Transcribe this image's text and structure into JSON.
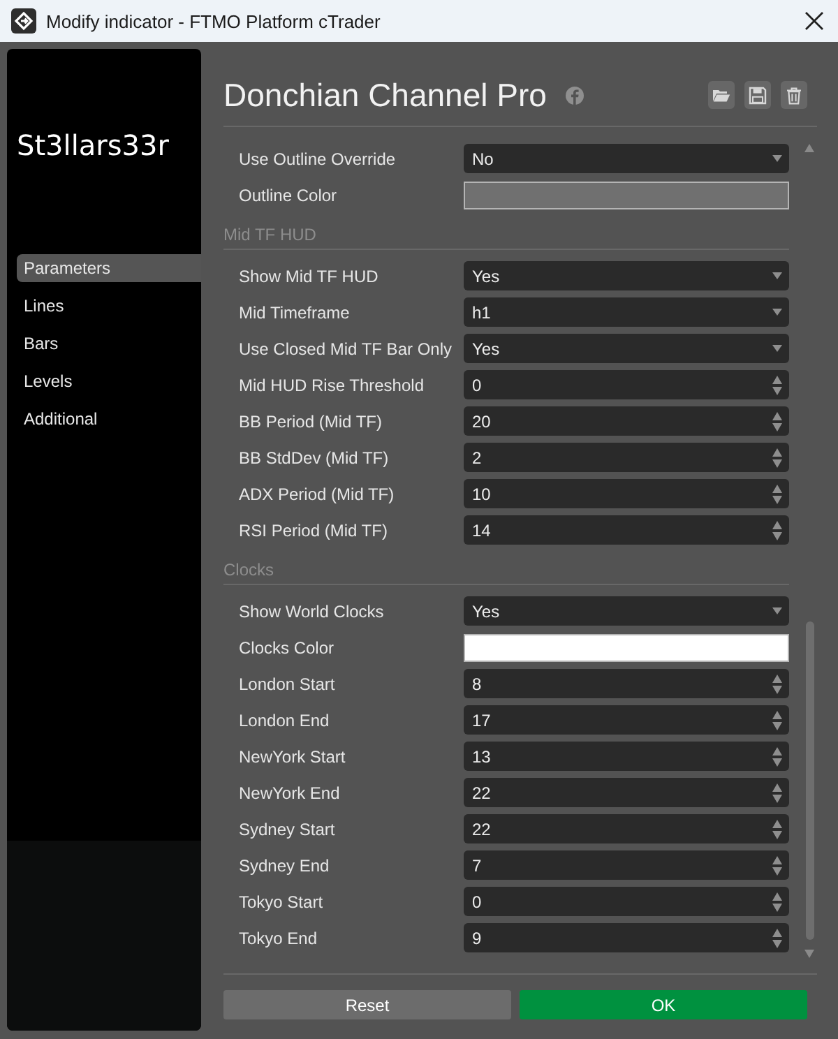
{
  "window": {
    "title": "Modify indicator - FTMO Platform cTrader"
  },
  "sidebar": {
    "logo": "St3llars33r",
    "items": [
      {
        "label": "Parameters",
        "selected": true
      },
      {
        "label": "Lines",
        "selected": false
      },
      {
        "label": "Bars",
        "selected": false
      },
      {
        "label": "Levels",
        "selected": false
      },
      {
        "label": "Additional",
        "selected": false
      }
    ]
  },
  "header": {
    "title": "Donchian Channel Pro"
  },
  "sections": [
    {
      "rows": [
        {
          "label": "Use Outline Override",
          "kind": "dropdown",
          "value": "No"
        },
        {
          "label": "Outline Color",
          "kind": "color",
          "color": "#707070"
        }
      ]
    },
    {
      "title": "Mid TF HUD",
      "rows": [
        {
          "label": "Show Mid TF HUD",
          "kind": "dropdown",
          "value": "Yes"
        },
        {
          "label": "Mid Timeframe",
          "kind": "dropdown",
          "value": "h1"
        },
        {
          "label": "Use Closed Mid TF Bar Only",
          "kind": "dropdown",
          "value": "Yes"
        },
        {
          "label": "Mid HUD Rise Threshold",
          "kind": "number",
          "value": "0"
        },
        {
          "label": "BB Period (Mid TF)",
          "kind": "number",
          "value": "20"
        },
        {
          "label": "BB StdDev (Mid TF)",
          "kind": "number",
          "value": "2"
        },
        {
          "label": "ADX Period (Mid TF)",
          "kind": "number",
          "value": "10"
        },
        {
          "label": "RSI Period (Mid TF)",
          "kind": "number",
          "value": "14"
        }
      ]
    },
    {
      "title": "Clocks",
      "rows": [
        {
          "label": "Show World Clocks",
          "kind": "dropdown",
          "value": "Yes"
        },
        {
          "label": "Clocks Color",
          "kind": "color",
          "color": "#ffffff"
        },
        {
          "label": "London Start",
          "kind": "number",
          "value": "8"
        },
        {
          "label": "London End",
          "kind": "number",
          "value": "17"
        },
        {
          "label": "NewYork Start",
          "kind": "number",
          "value": "13"
        },
        {
          "label": "NewYork End",
          "kind": "number",
          "value": "22"
        },
        {
          "label": "Sydney Start",
          "kind": "number",
          "value": "22"
        },
        {
          "label": "Sydney End",
          "kind": "number",
          "value": "7"
        },
        {
          "label": "Tokyo Start",
          "kind": "number",
          "value": "0"
        },
        {
          "label": "Tokyo End",
          "kind": "number",
          "value": "9"
        }
      ]
    }
  ],
  "buttons": [
    {
      "label": "Reset",
      "kind": "secondary"
    },
    {
      "label": "OK",
      "kind": "primary"
    }
  ]
}
